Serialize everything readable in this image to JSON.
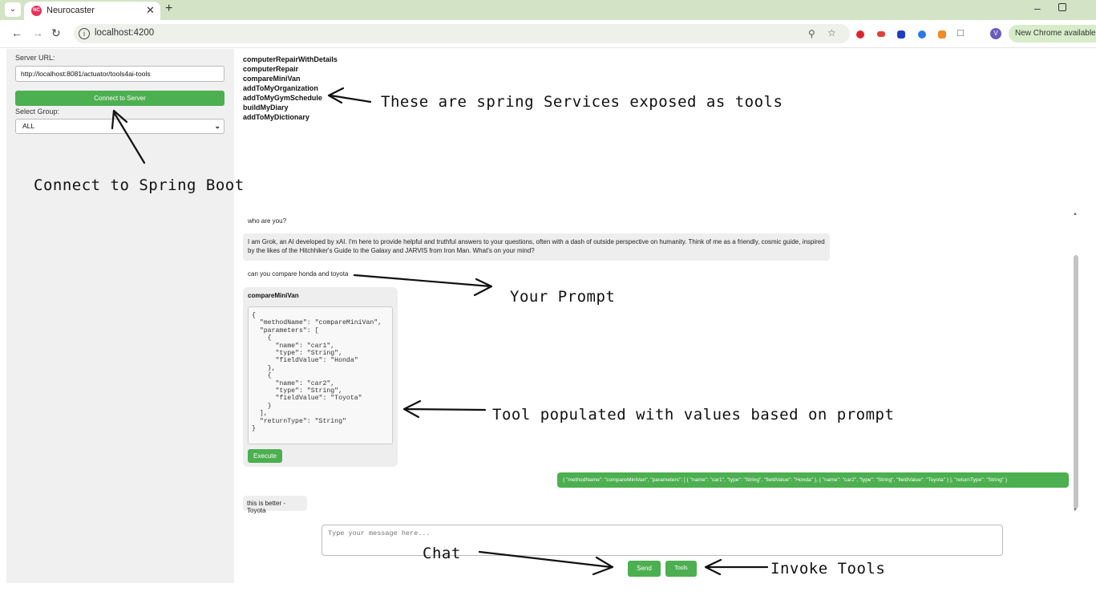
{
  "browser": {
    "tab_title": "Neurocaster",
    "favicon_text": "NC",
    "url": "localhost:4200",
    "update_chip": "New Chrome available",
    "profile_initial": "V"
  },
  "sidebar": {
    "server_url_label": "Server URL:",
    "server_url_value": "http://localhost:8081/actuator/tools4ai-tools",
    "connect_button": "Connect to Server",
    "select_group_label": "Select Group:",
    "select_group_value": "ALL"
  },
  "tools": [
    "computerRepairWithDetails",
    "computerRepair",
    "compareMiniVan",
    "addToMyOrganization",
    "addToMyGymSchedule",
    "buildMyDiary",
    "addToMyDictionary"
  ],
  "chat": {
    "messages": [
      {
        "role": "user",
        "text": "who are you?"
      },
      {
        "role": "assistant",
        "text": "I am Grok, an AI developed by xAI. I'm here to provide helpful and truthful answers to your questions, often with a dash of outside perspective on humanity. Think of me as a friendly, cosmic guide, inspired by the likes of the Hitchhiker's Guide to the Galaxy and JARVIS from Iron Man. What's on your mind?"
      },
      {
        "role": "user",
        "text": "can you compare honda and toyota"
      }
    ],
    "tool_card": {
      "title": "compareMiniVan",
      "json": "{\n  \"methodName\": \"compareMiniVan\",\n  \"parameters\": [\n    {\n      \"name\": \"car1\",\n      \"type\": \"String\",\n      \"fieldValue\": \"Honda\"\n    },\n    {\n      \"name\": \"car2\",\n      \"type\": \"String\",\n      \"fieldValue\": \"Toyota\"\n    }\n  ],\n  \"returnType\": \"String\"\n}",
      "execute_button": "Execute"
    },
    "executed_json": "{ \"methodName\": \"compareMiniVan\", \"parameters\": [ { \"name\": \"car1\", \"type\": \"String\", \"fieldValue\": \"Honda\" }, { \"name\": \"car2\", \"type\": \"String\", \"fieldValue\": \"Toyota\" } ], \"returnType\": \"String\" }",
    "result": "this is better - Toyota",
    "input_placeholder": "Type your message here...",
    "send_button": "Send",
    "tools_button": "Tools"
  },
  "annotations": {
    "tools_exposed": "These are spring Services exposed as tools",
    "connect": "Connect to Spring Boot",
    "prompt": "Your Prompt",
    "tool_populated": "Tool populated with values based on prompt",
    "chat": "Chat",
    "invoke_tools": "Invoke Tools"
  },
  "colors": {
    "accent_green": "#4caf50",
    "tab_bar": "#d3e3c6",
    "sidebar_bg": "#f0f0f0"
  }
}
